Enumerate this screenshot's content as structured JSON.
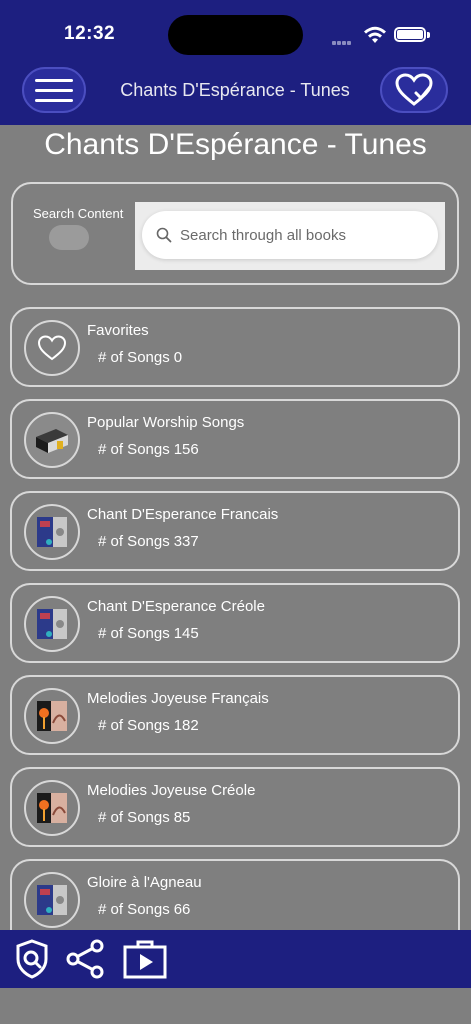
{
  "status": {
    "time": "12:32"
  },
  "header": {
    "title": "Chants D'Espérance - Tunes"
  },
  "page_title": "Chants D'Espérance - Tunes",
  "search": {
    "label": "Search Content",
    "placeholder": "Search through all books"
  },
  "books": [
    {
      "title": "Favorites",
      "count_label": "# of Songs",
      "count": "0",
      "icon": "heart-icon"
    },
    {
      "title": "Popular Worship Songs",
      "count_label": "# of Songs",
      "count": "156",
      "icon": "book-icon"
    },
    {
      "title": "Chant D'Esperance Francais",
      "count_label": "# of Songs",
      "count": "337",
      "icon": "book-cover-icon"
    },
    {
      "title": "Chant D'Esperance Créole",
      "count_label": "# of Songs",
      "count": "145",
      "icon": "book-cover-icon"
    },
    {
      "title": "Melodies Joyeuse Français",
      "count_label": "# of Songs",
      "count": "182",
      "icon": "book-cover-icon"
    },
    {
      "title": "Melodies Joyeuse Créole",
      "count_label": "# of Songs",
      "count": "85",
      "icon": "book-cover-icon"
    },
    {
      "title": "Gloire à l'Agneau",
      "count_label": "# of Songs",
      "count": "66",
      "icon": "book-cover-icon"
    }
  ],
  "footer": {
    "icons": [
      "privacy-shield-icon",
      "share-icon",
      "tutorial-video-icon"
    ]
  },
  "colors": {
    "header_bg": "#1d1f80",
    "page_bg": "#7f7f7f",
    "border": "#d8d8d8"
  }
}
